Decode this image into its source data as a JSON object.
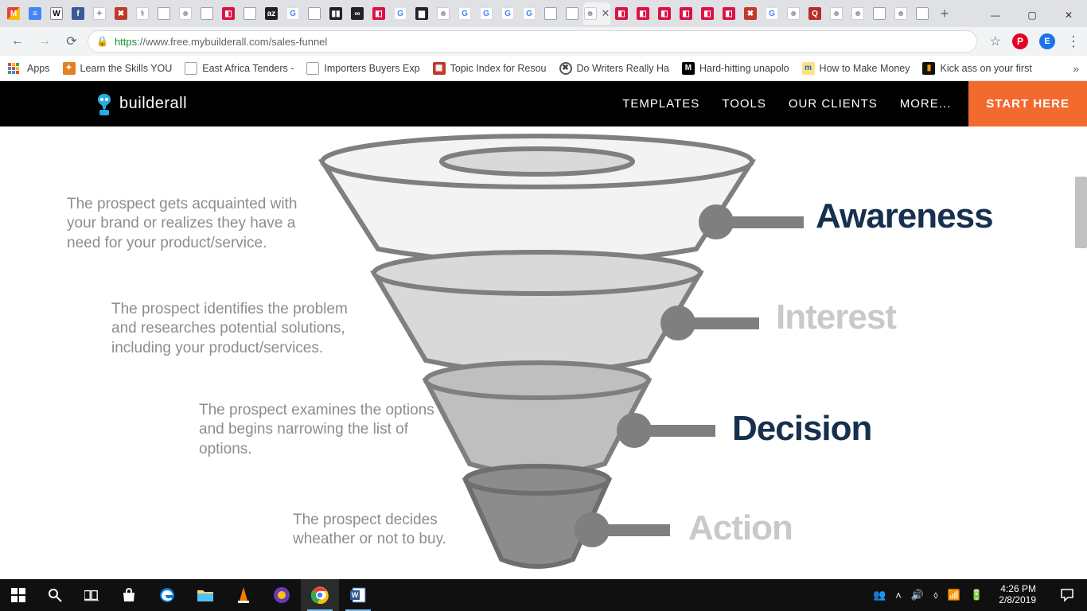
{
  "browser": {
    "url_secure": "https",
    "url_rest": "://www.free.mybuilderall.com/sales-funnel",
    "profile_initial": "E",
    "pinterest_initial": "P",
    "tabs_hint_count": 28,
    "win": {
      "min": "—",
      "max": "▢",
      "close": "✕"
    }
  },
  "bookmarks": {
    "apps": "Apps",
    "items": [
      {
        "label": "Learn the Skills YOU "
      },
      {
        "label": "East Africa Tenders -"
      },
      {
        "label": "Importers Buyers Exp"
      },
      {
        "label": "Topic Index for Resou"
      },
      {
        "label": "Do Writers Really Ha"
      },
      {
        "label": "Hard-hitting unapolo"
      },
      {
        "label": "How to Make Money"
      },
      {
        "label": "Kick ass on your first"
      }
    ]
  },
  "site": {
    "brand": "builderall",
    "nav": {
      "templates": "TEMPLATES",
      "tools": "TOOLS",
      "our_clients": "OUR CLIENTS",
      "more": "MORE...",
      "start_here": "START HERE"
    },
    "stages": {
      "awareness": {
        "title": "Awareness",
        "desc": "The prospect gets acquainted with your brand or realizes they have a need for your product/service."
      },
      "interest": {
        "title": "Interest",
        "desc": "The prospect identifies the problem and researches potential solutions, including your product/services."
      },
      "decision": {
        "title": "Decision",
        "desc": "The prospect examines the options and begins narrowing the list of options."
      },
      "action": {
        "title": "Action",
        "desc": "The prospect decides wheather or not to buy."
      }
    }
  },
  "taskbar": {
    "time": "4:26 PM",
    "date": "2/8/2019"
  },
  "colors": {
    "cta": "#f26a2e",
    "heading_dark": "#16304d",
    "heading_muted": "#c9c9c9",
    "body_text": "#8d8d8d"
  }
}
